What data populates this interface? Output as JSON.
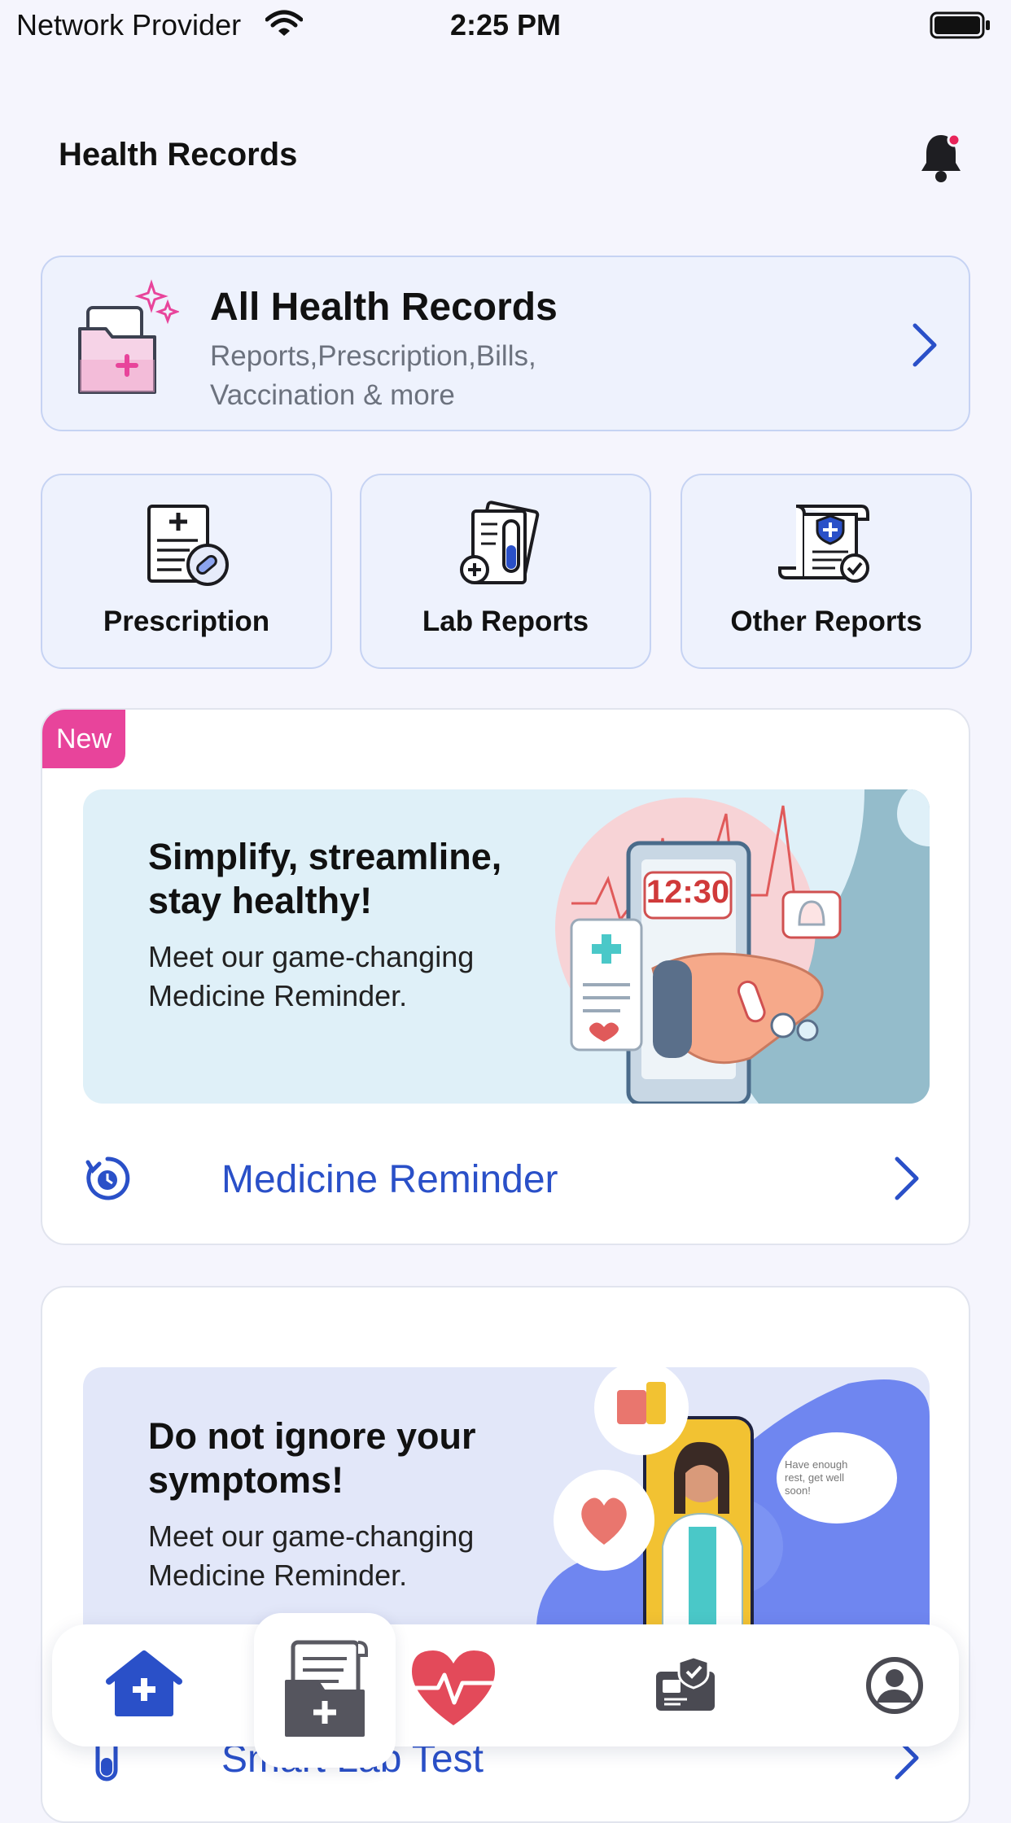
{
  "status_bar": {
    "carrier": "Network Provider",
    "time": "2:25 PM"
  },
  "header": {
    "title": "Health Records"
  },
  "all_records": {
    "title": "All Health Records",
    "subtitle": "Reports,Prescription,Bills, Vaccination & more"
  },
  "categories": [
    {
      "label": "Prescription"
    },
    {
      "label": "Lab Reports"
    },
    {
      "label": "Other Reports"
    }
  ],
  "reminder_card": {
    "badge": "New",
    "banner_heading": "Simplify, streamline, stay healthy!",
    "banner_text": "Meet our game-changing Medicine Reminder.",
    "banner_clock": "12:30",
    "link_label": "Medicine Reminder"
  },
  "symptoms_card": {
    "banner_heading": "Do not ignore your symptoms!",
    "banner_text": "Meet our game-changing Medicine Reminder.",
    "bubble_text": "Have enough rest, get well soon!",
    "link_label": "Smart Lab Test"
  },
  "tabbar": {
    "tabs": [
      {
        "icon": "home-plus-icon",
        "active": true
      },
      {
        "icon": "records-folder-icon",
        "active": false
      },
      {
        "icon": "heart-pulse-icon",
        "active": false
      },
      {
        "icon": "insurance-card-icon",
        "active": false
      },
      {
        "icon": "profile-icon",
        "active": false
      }
    ]
  },
  "colors": {
    "accent": "#2a50c8",
    "badge": "#e8449b",
    "tile_bg": "#eef2fd",
    "page_bg": "#f5f5fd"
  }
}
